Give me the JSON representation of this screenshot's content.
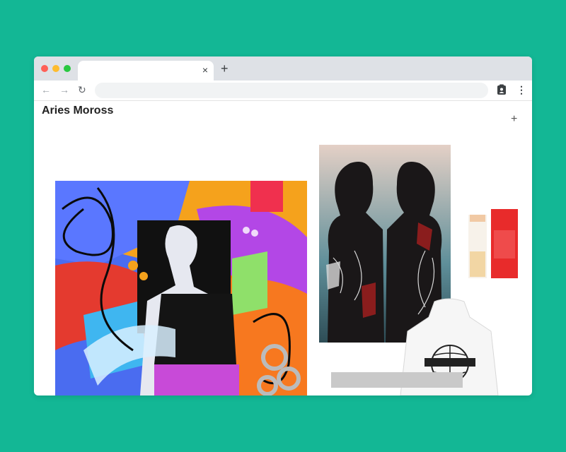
{
  "browser": {
    "tab_close": "×",
    "new_tab": "+",
    "back": "←",
    "forward": "→",
    "reload": "↻",
    "menu": "⋮"
  },
  "page": {
    "title": "Aries Moross",
    "add_button": "+"
  },
  "colors": {
    "background": "#13b795",
    "tabbar": "#dee1e6",
    "address_bar": "#f1f3f4"
  },
  "icons": [
    "close-icon",
    "plus-icon",
    "back-arrow-icon",
    "forward-arrow-icon",
    "reload-icon",
    "extension-icon",
    "menu-icon"
  ]
}
